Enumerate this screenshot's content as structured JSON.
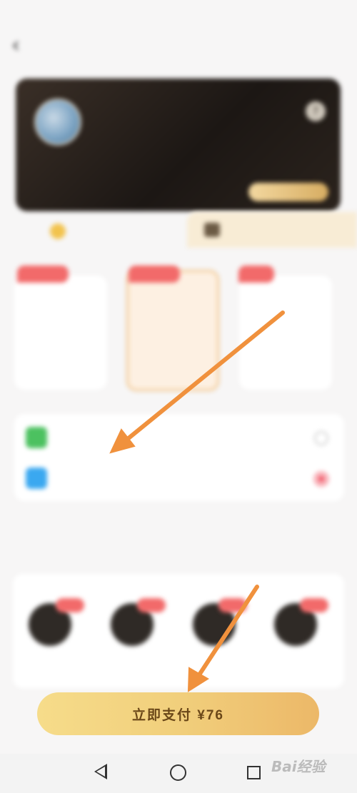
{
  "status_bar": {
    "left": "",
    "right": ""
  },
  "header": {
    "back": "‹",
    "title": "",
    "right_link": ""
  },
  "card": {
    "name": "",
    "subtitle": "",
    "watermark": "",
    "help": "?",
    "button": ""
  },
  "tabs": {
    "vip": "",
    "svip": ""
  },
  "plans": [
    {
      "tag": "",
      "name": "",
      "note": "",
      "price": "",
      "orig": ""
    },
    {
      "tag": "",
      "name": "",
      "note": "",
      "price": "",
      "orig": ""
    },
    {
      "tag": "",
      "name": "",
      "note": "",
      "price": "",
      "orig": ""
    }
  ],
  "payment": {
    "methods": [
      {
        "label": "",
        "icon": "wechat-icon",
        "color": "#4cc160",
        "selected": false
      },
      {
        "label": "",
        "icon": "alipay-icon",
        "color": "#3aa8f0",
        "selected": true
      }
    ]
  },
  "benefits": {
    "title": "",
    "items": [
      {
        "label": ""
      },
      {
        "label": ""
      },
      {
        "label": ""
      },
      {
        "label": ""
      }
    ]
  },
  "pay_button": {
    "label": "立即支付 ¥76"
  },
  "watermark": {
    "brand": "Bai经验",
    "sub": ""
  },
  "colors": {
    "accent_gold": "#f1cf7c",
    "tag_red": "#f26a6a",
    "arrow_orange": "#f0913d"
  }
}
